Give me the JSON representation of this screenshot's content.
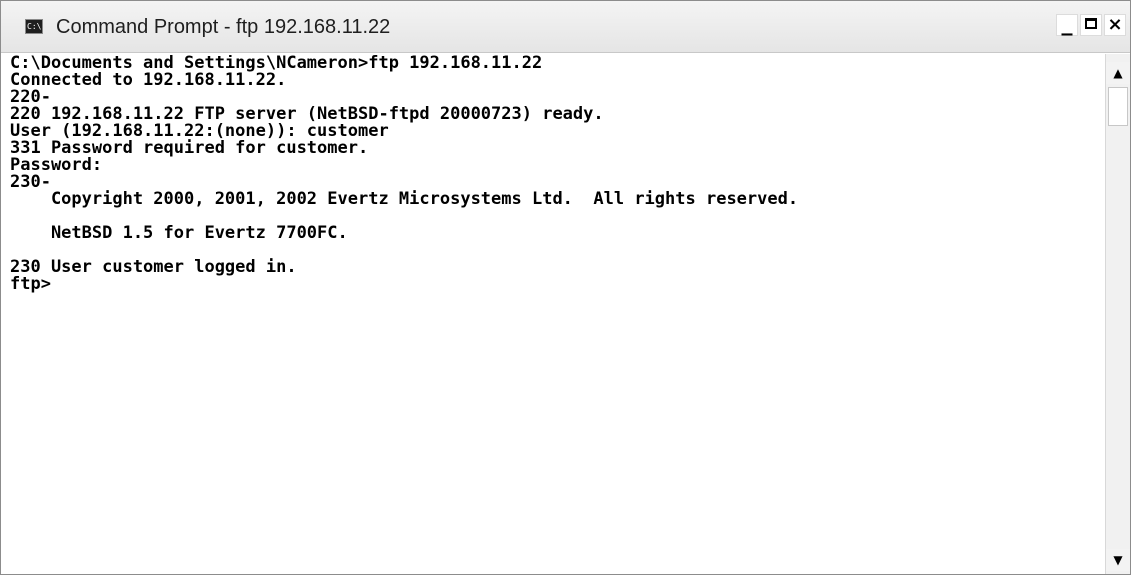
{
  "window": {
    "title": "Command Prompt - ftp 192.168.11.22",
    "icon_label": "C:\\",
    "icon": "command-prompt-icon",
    "controls": {
      "minimize": "minimize-icon",
      "maximize": "maximize-icon",
      "close": "close-icon"
    }
  },
  "console": {
    "lines": [
      "C:\\Documents and Settings\\NCameron>ftp 192.168.11.22",
      "Connected to 192.168.11.22.",
      "220-",
      "220 192.168.11.22 FTP server (NetBSD-ftpd 20000723) ready.",
      "User (192.168.11.22:(none)): customer",
      "331 Password required for customer.",
      "Password:",
      "230-",
      "    Copyright 2000, 2001, 2002 Evertz Microsystems Ltd.  All rights reserved.",
      "",
      "    NetBSD 1.5 for Evertz 7700FC.",
      "",
      "230 User customer logged in.",
      "ftp>"
    ]
  },
  "scrollbar": {
    "up_icon": "scroll-up-arrow-icon",
    "down_icon": "scroll-down-arrow-icon"
  }
}
